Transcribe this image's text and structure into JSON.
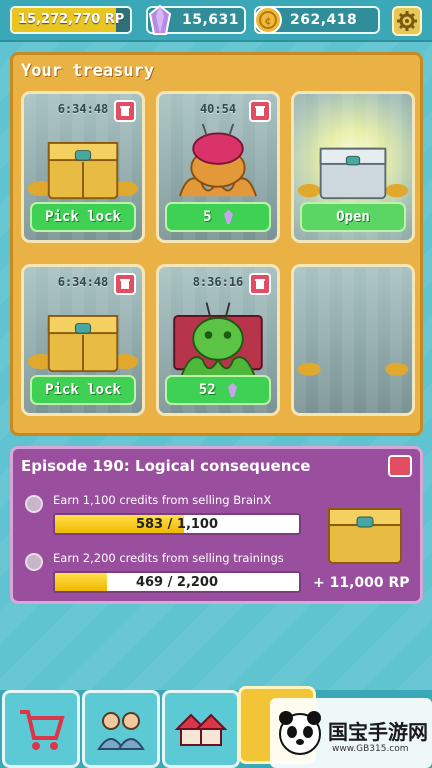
{
  "header": {
    "rp_label": "15,272,770 RP",
    "rp_progress": 0.88,
    "gems_value": "15,631",
    "coins_value": "262,418",
    "icons": [
      "gem-icon",
      "coin-icon",
      "gear-icon"
    ]
  },
  "treasury": {
    "title": "Your treasury",
    "slots": [
      {
        "timer": "6:34:48",
        "chest": "gold-chest",
        "button": "Pick lock"
      },
      {
        "timer": "40:54",
        "chest": "octopus-creature",
        "button": "5"
      },
      {
        "timer": "",
        "chest": "silver-chest",
        "button": "Open"
      },
      {
        "timer": "6:34:48",
        "chest": "gold-chest",
        "button": "Pick lock"
      },
      {
        "timer": "8:36:16",
        "chest": "green-octopus-creature",
        "button": "52"
      },
      {
        "timer": "",
        "chest": "empty",
        "button": ""
      }
    ]
  },
  "episode": {
    "title": "Episode 190: Logical consequence",
    "tasks": [
      {
        "desc": "Earn 1,100 credits from selling BrainX",
        "progress": "583 / 1,100",
        "fraction": 0.53
      },
      {
        "desc": "Earn 2,200 credits from selling trainings",
        "progress": "469 / 2,200",
        "fraction": 0.213
      }
    ],
    "reward": "+ 11,000 RP"
  },
  "nav": {
    "tabs": [
      "cart-icon",
      "people-icon",
      "house-icon",
      "active-tab"
    ]
  },
  "watermark": {
    "text": "国宝手游网",
    "url": "www.GB315.com"
  },
  "colors": {
    "background": "#5fc4cf",
    "treasury_panel": "#eab144",
    "episode_panel": "#9a4f9e",
    "button_green": "#3fd154",
    "progress_yellow": "#f0b800"
  }
}
